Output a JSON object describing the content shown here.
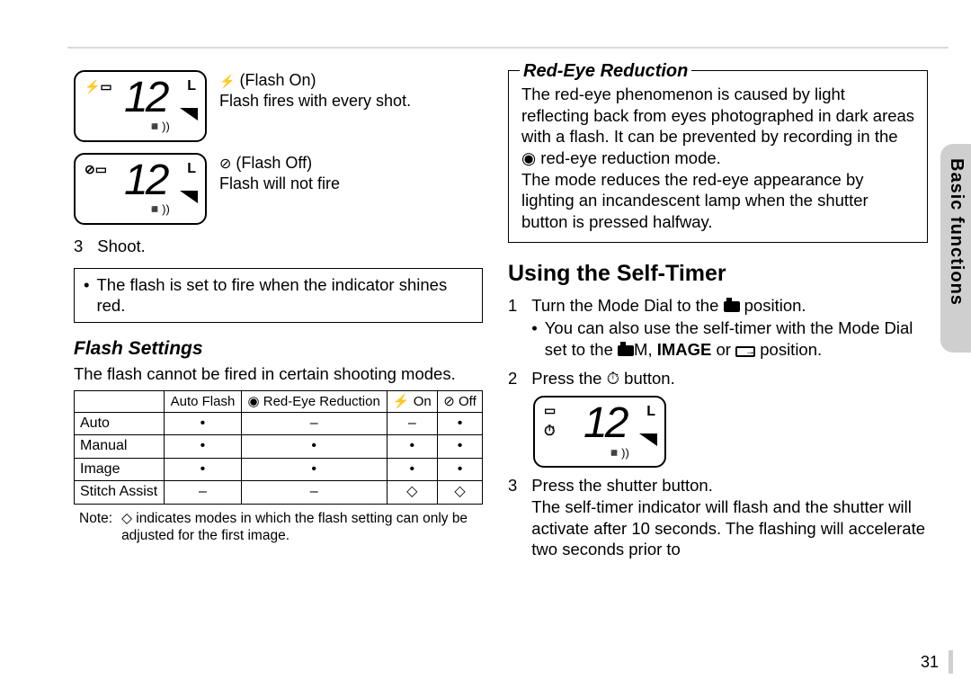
{
  "section_tab": "Basic functions",
  "page_number": "31",
  "left": {
    "lcd1": {
      "topleft": "⚡▭",
      "big": "12",
      "l": "L",
      "sound": "◾))",
      "label": "(Flash On)",
      "desc": "Flash fires with every shot."
    },
    "lcd2": {
      "topleft": "⊘▭",
      "big": "12",
      "l": "L",
      "sound": "◾))",
      "label": "(Flash Off)",
      "desc": "Flash will not fire"
    },
    "step3_num": "3",
    "step3_text": "Shoot.",
    "note_box_bullet": "•",
    "note_box_text": "The flash is set to fire when the indicator shines red.",
    "flash_settings_heading": "Flash Settings",
    "flash_settings_intro": "The flash cannot be fired in certain shooting modes.",
    "table": {
      "headers": [
        "",
        "Auto Flash",
        "◉ Red-Eye Reduction",
        "⚡ On",
        "⊘ Off"
      ],
      "rows": [
        [
          "Auto",
          "•",
          "–",
          "–",
          "•"
        ],
        [
          "Manual",
          "•",
          "•",
          "•",
          "•"
        ],
        [
          "Image",
          "•",
          "•",
          "•",
          "•"
        ],
        [
          "Stitch Assist",
          "–",
          "–",
          "◇",
          "◇"
        ]
      ]
    },
    "footnote_label": "Note:",
    "footnote_text": "◇ indicates modes in which the flash setting can only be adjusted for the first image."
  },
  "right": {
    "frame_title": "Red-Eye Reduction",
    "frame_p1": "The red-eye phenomenon is caused by light reflecting back from eyes photo­graphed in dark areas with a flash.  It can be prevented by recording in the ◉ red-eye reduction mode.",
    "frame_p2": "The mode reduces the red-eye appearance by lighting an incandescent lamp when the shutter button is pressed halfway.",
    "h2": "Using the Self-Timer",
    "s1_num": "1",
    "s1_text_a": "Turn the Mode Dial to the ",
    "s1_text_b": " position.",
    "s1_bullet": "•",
    "s1_sub_a": "You can also use the self-timer with the Mode Dial set to the ",
    "s1_sub_m": "M",
    "s1_sub_b": ", ",
    "s1_sub_image": "IMAGE",
    "s1_sub_c": " or ",
    "s1_sub_d": " position.",
    "s2_num": "2",
    "s2_text": "Press the ⏱ button.",
    "lcd3": {
      "topleft": "▭",
      "left2": "⏱",
      "big": "12",
      "l": "L",
      "sound": "◾))"
    },
    "s3_num": "3",
    "s3_text": "Press the shutter button.",
    "s3_desc": "The self-timer indicator will flash and the shutter will activate after 10 seconds. The flashing will accelerate two seconds prior to"
  }
}
